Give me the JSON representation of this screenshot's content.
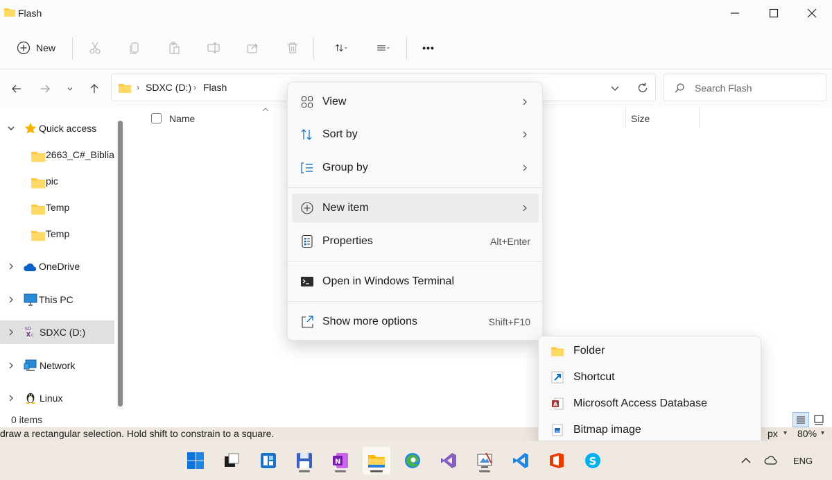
{
  "window": {
    "title": "Flash"
  },
  "toolbar": {
    "new_label": "New",
    "more_label": "•••"
  },
  "address": {
    "crumbs": [
      "SDXC (D:)",
      "Flash"
    ],
    "search_placeholder": "Search Flash"
  },
  "navpane": {
    "items": [
      {
        "label": "Quick access",
        "icon": "star-icon"
      },
      {
        "label": "2663_C#_Biblia",
        "icon": "folder-icon"
      },
      {
        "label": "pic",
        "icon": "folder-icon"
      },
      {
        "label": "Temp",
        "icon": "folder-icon"
      },
      {
        "label": "Temp",
        "icon": "folder-icon"
      },
      {
        "label": "OneDrive",
        "icon": "cloud-icon"
      },
      {
        "label": "This PC",
        "icon": "monitor-icon"
      },
      {
        "label": "SDXC (D:)",
        "icon": "sd-card-icon"
      },
      {
        "label": "Network",
        "icon": "network-icon"
      },
      {
        "label": "Linux",
        "icon": "penguin-icon"
      }
    ]
  },
  "content": {
    "col_name": "Name",
    "col_size": "Size"
  },
  "status": {
    "items_count": "0 items"
  },
  "hintbar": {
    "hint": "draw a rectangular selection. Hold shift to constrain to a square.",
    "unit": "px",
    "zoom": "80%"
  },
  "context_menu": {
    "items": [
      {
        "label": "View",
        "icon": "grid-icon",
        "submenu": true
      },
      {
        "label": "Sort by",
        "icon": "sort-icon",
        "submenu": true
      },
      {
        "label": "Group by",
        "icon": "group-icon",
        "submenu": true
      },
      {
        "label": "New item",
        "icon": "plus-circle-icon",
        "submenu": true
      },
      {
        "label": "Properties",
        "icon": "properties-icon",
        "shortcut": "Alt+Enter"
      },
      {
        "label": "Open in Windows Terminal",
        "icon": "terminal-icon"
      },
      {
        "label": "Show more options",
        "icon": "share-icon",
        "shortcut": "Shift+F10"
      }
    ]
  },
  "submenu": {
    "items": [
      {
        "label": "Folder",
        "icon": "folder-icon"
      },
      {
        "label": "Shortcut",
        "icon": "shortcut-icon"
      },
      {
        "label": "Microsoft Access Database",
        "icon": "access-icon"
      },
      {
        "label": "Bitmap image",
        "icon": "bitmap-icon"
      }
    ]
  },
  "taskbar": {
    "apps": [
      "start",
      "task-view",
      "widgets",
      "save-app",
      "onenote",
      "file-explorer",
      "edge",
      "visual-studio",
      "paint",
      "vscode",
      "office",
      "skype"
    ],
    "lang": "ENG"
  },
  "colors": {
    "accent": "#0067c0",
    "folder": "#ffc83d",
    "taskbar": "#f0e9e1"
  }
}
